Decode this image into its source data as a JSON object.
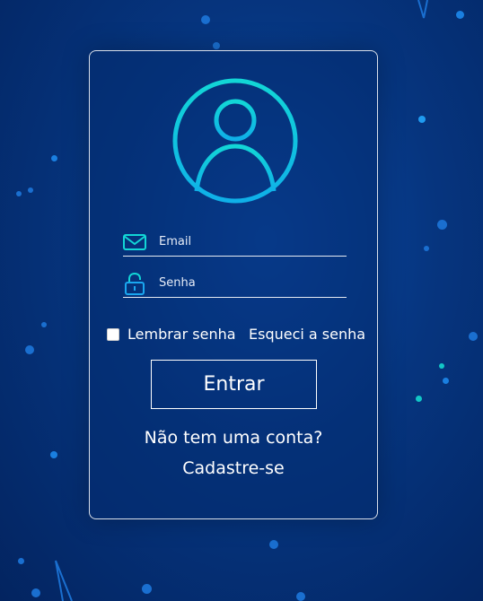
{
  "login": {
    "email_placeholder": "Email",
    "password_placeholder": "Senha",
    "remember_label": "Lembrar senha",
    "forgot_label": "Esqueci a senha",
    "submit_label": "Entrar",
    "no_account_text": "Não tem uma conta?",
    "signup_label": "Cadastre-se",
    "remember_checked": false
  },
  "icons": {
    "avatar": "user-avatar-icon",
    "email": "envelope-icon",
    "password": "padlock-icon"
  },
  "colors": {
    "accent_cyan": "#12d6d6",
    "accent_blue": "#1aa7f0",
    "background_dark": "#032460",
    "background_mid": "#0a4aa8",
    "text": "#ffffff"
  }
}
